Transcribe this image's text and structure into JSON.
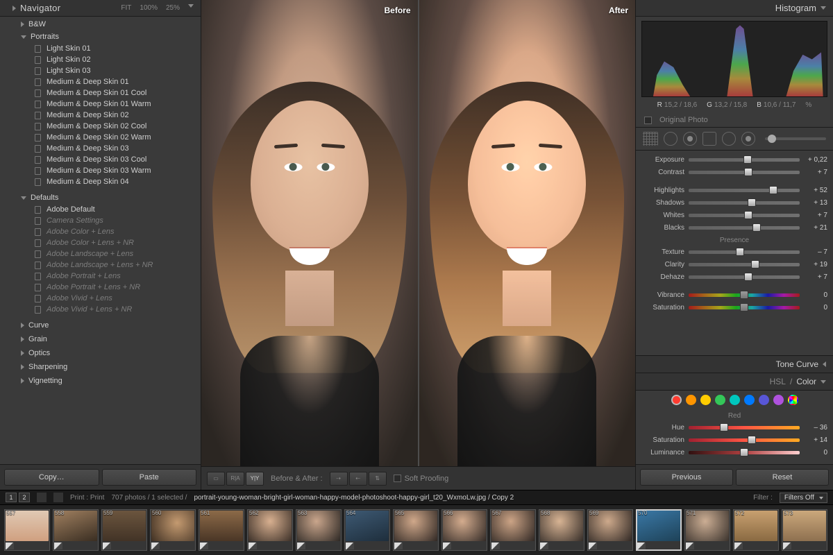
{
  "navigator": {
    "title": "Navigator",
    "zoom": {
      "fit": "FIT",
      "full": "100%",
      "current": "25%"
    }
  },
  "presets": {
    "bw_group": "B&W",
    "portraits_group": "Portraits",
    "portraits": [
      "Light Skin 01",
      "Light Skin 02",
      "Light Skin 03",
      "Medium & Deep Skin 01",
      "Medium & Deep Skin 01 Cool",
      "Medium & Deep Skin 01 Warm",
      "Medium & Deep Skin 02",
      "Medium & Deep Skin 02 Cool",
      "Medium & Deep Skin 02 Warm",
      "Medium & Deep Skin 03",
      "Medium & Deep Skin 03 Cool",
      "Medium & Deep Skin 03 Warm",
      "Medium & Deep Skin 04"
    ],
    "defaults_group": "Defaults",
    "defaults": [
      {
        "label": "Adobe Default",
        "italic": false
      },
      {
        "label": "Camera Settings",
        "italic": true
      },
      {
        "label": "Adobe Color + Lens",
        "italic": true
      },
      {
        "label": "Adobe Color + Lens + NR",
        "italic": true
      },
      {
        "label": "Adobe Landscape + Lens",
        "italic": true
      },
      {
        "label": "Adobe Landscape + Lens + NR",
        "italic": true
      },
      {
        "label": "Adobe Portrait + Lens",
        "italic": true
      },
      {
        "label": "Adobe Portrait + Lens + NR",
        "italic": true
      },
      {
        "label": "Adobe Vivid + Lens",
        "italic": true
      },
      {
        "label": "Adobe Vivid + Lens + NR",
        "italic": true
      }
    ],
    "sections": [
      "Curve",
      "Grain",
      "Optics",
      "Sharpening",
      "Vignetting"
    ]
  },
  "left_buttons": {
    "copy": "Copy…",
    "paste": "Paste"
  },
  "preview": {
    "before": "Before",
    "after": "After"
  },
  "center_toolbar": {
    "before_after_label": "Before & After :",
    "soft_proofing": "Soft Proofing"
  },
  "histogram": {
    "title": "Histogram",
    "readout": {
      "r_label": "R",
      "r": "15,2 / 18,6",
      "g_label": "G",
      "g": "13,2 / 15,8",
      "b_label": "B",
      "b": "10,6 / 11,7",
      "pct": "%"
    },
    "original_photo": "Original Photo"
  },
  "basic": {
    "exposure": {
      "label": "Exposure",
      "value": "+ 0,22",
      "pos": 53
    },
    "contrast": {
      "label": "Contrast",
      "value": "+ 7",
      "pos": 54
    },
    "highlights": {
      "label": "Highlights",
      "value": "+ 52",
      "pos": 76
    },
    "shadows": {
      "label": "Shadows",
      "value": "+ 13",
      "pos": 57
    },
    "whites": {
      "label": "Whites",
      "value": "+ 7",
      "pos": 54
    },
    "blacks": {
      "label": "Blacks",
      "value": "+ 21",
      "pos": 61
    },
    "presence_title": "Presence",
    "texture": {
      "label": "Texture",
      "value": "– 7",
      "pos": 46
    },
    "clarity": {
      "label": "Clarity",
      "value": "+ 19",
      "pos": 60
    },
    "dehaze": {
      "label": "Dehaze",
      "value": "+ 7",
      "pos": 54
    },
    "vibrance": {
      "label": "Vibrance",
      "value": "0",
      "pos": 50
    },
    "saturation": {
      "label": "Saturation",
      "value": "0",
      "pos": 50
    }
  },
  "panels": {
    "tone_curve": "Tone Curve",
    "hsl": "HSL",
    "color": "Color"
  },
  "hsl": {
    "colors": [
      "#ff3b30",
      "#ff9500",
      "#ffcc00",
      "#34c759",
      "#00c7be",
      "#007aff",
      "#5856d6",
      "#af52de"
    ],
    "selected": 0,
    "red_title": "Red",
    "hue": {
      "label": "Hue",
      "value": "– 36",
      "pos": 32
    },
    "sat": {
      "label": "Saturation",
      "value": "+ 14",
      "pos": 57
    },
    "lum": {
      "label": "Luminance",
      "value": "0",
      "pos": 50
    }
  },
  "right_buttons": {
    "previous": "Previous",
    "reset": "Reset"
  },
  "info": {
    "page1": "1",
    "page2": "2",
    "breadcrumb": "Print : Print",
    "count": "707 photos / 1 selected /",
    "filename": "portrait-young-woman-bright-girl-woman-happy-model-photoshoot-happy-girl_t20_WxmoLw.jpg / Copy 2",
    "filter_label": "Filter :",
    "filter_value": "Filters Off"
  },
  "filmstrip": {
    "start_index": 557,
    "selected_index": 570
  }
}
